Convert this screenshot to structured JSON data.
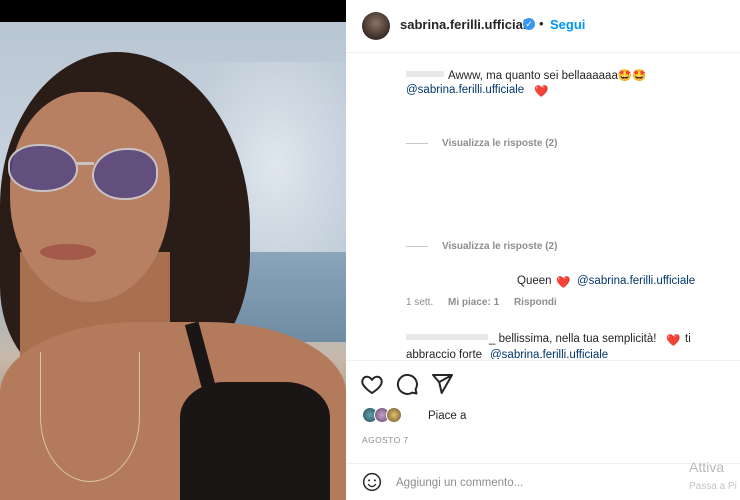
{
  "post": {
    "username": "sabrina.ferilli.ufficiale",
    "verified_mark": "✓",
    "separator": "•",
    "follow_label": "Segui"
  },
  "comments": [
    {
      "text": "Awww, ma quanto sei bellaaaaaa🤩🤩",
      "mention": "@sabrina.ferilli.ufficiale",
      "suffix": "❤️"
    },
    {
      "replies_label": "Visualizza le risposte (2)"
    },
    {
      "replies_label": "Visualizza le risposte (2)"
    },
    {
      "text": "Queen",
      "heart": "❤️",
      "mention": "@sabrina.ferilli.ufficiale",
      "time": "1 sett.",
      "likes": "Mi piace: 1",
      "reply": "Rispondi"
    },
    {
      "text": "_ bellissima, nella tua semplicità!",
      "heart": "❤️",
      "tail": "ti",
      "line2": "abbraccio forte",
      "mention": "@sabrina.ferilli.ufficiale"
    }
  ],
  "actions": {
    "like_icon": "heart-outline-icon",
    "comment_icon": "comment-bubble-icon",
    "share_icon": "paper-plane-icon"
  },
  "likes": {
    "label": "Piace a"
  },
  "date": "AGOSTO 7",
  "add_comment": {
    "placeholder": "Aggiungi un commento...",
    "emoji_icon": "smiley-icon"
  },
  "watermark": {
    "line1": "Attiva",
    "line2": "Passa a Pi"
  },
  "colors": {
    "link": "#0095f6",
    "mention": "#00376b",
    "heart": "#e0245e",
    "muted": "#8e8e8e"
  }
}
